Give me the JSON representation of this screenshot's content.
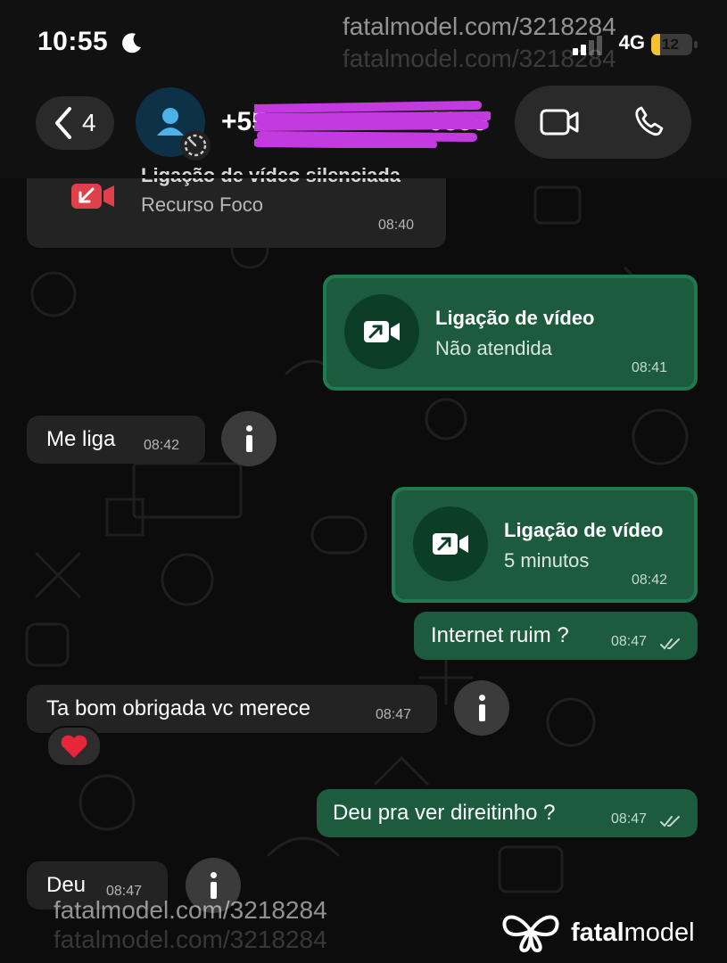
{
  "status_bar": {
    "time": "10:55",
    "carrier": "4G",
    "battery": "12"
  },
  "header": {
    "back_count": "4",
    "contact_number": "+55",
    "contact_number_tail": "3399"
  },
  "watermarks": {
    "top": "fatalmodel.com/3218284",
    "bottom": "fatalmodel.com/3218284",
    "logo_bold": "fatal",
    "logo_regular": "model"
  },
  "messages": [
    {
      "id": "m1",
      "direction": "in",
      "kind": "call",
      "title": "Ligação de vídeo silenciada",
      "subtitle": "Recurso Foco",
      "time": "08:40"
    },
    {
      "id": "m2",
      "direction": "out",
      "kind": "call",
      "title": "Ligação de vídeo",
      "subtitle": "Não atendida",
      "time": "08:41"
    },
    {
      "id": "m3",
      "direction": "in",
      "kind": "text",
      "text": "Me liga",
      "time": "08:42"
    },
    {
      "id": "m4",
      "direction": "out",
      "kind": "call",
      "title": "Ligação de vídeo",
      "subtitle": "5 minutos",
      "time": "08:42"
    },
    {
      "id": "m5",
      "direction": "out",
      "kind": "text",
      "text": "Internet ruim ?",
      "time": "08:47",
      "read": true
    },
    {
      "id": "m6",
      "direction": "in",
      "kind": "text",
      "text": "Ta bom obrigada vc merece",
      "time": "08:47",
      "reaction": "❤️"
    },
    {
      "id": "m7",
      "direction": "out",
      "kind": "text",
      "text": "Deu pra ver direitinho ?",
      "time": "08:47",
      "read": true
    },
    {
      "id": "m8",
      "direction": "in",
      "kind": "text",
      "text": "Deu",
      "time": "08:47"
    }
  ],
  "colors": {
    "incoming_bubble": "#232323",
    "outgoing_bubble": "#1c5b3e",
    "outgoing_border": "#207a4f",
    "background": "#0c0c0c",
    "missed_call_icon": "#e0404a",
    "redaction": "#c33be0"
  },
  "icons": {
    "back": "chevron-left-icon",
    "avatar": "person-icon",
    "video": "video-camera-icon",
    "phone": "phone-icon",
    "missed": "missed-video-call-icon",
    "outgoing_call": "outgoing-video-call-icon",
    "info": "info-icon",
    "read": "double-check-icon"
  }
}
